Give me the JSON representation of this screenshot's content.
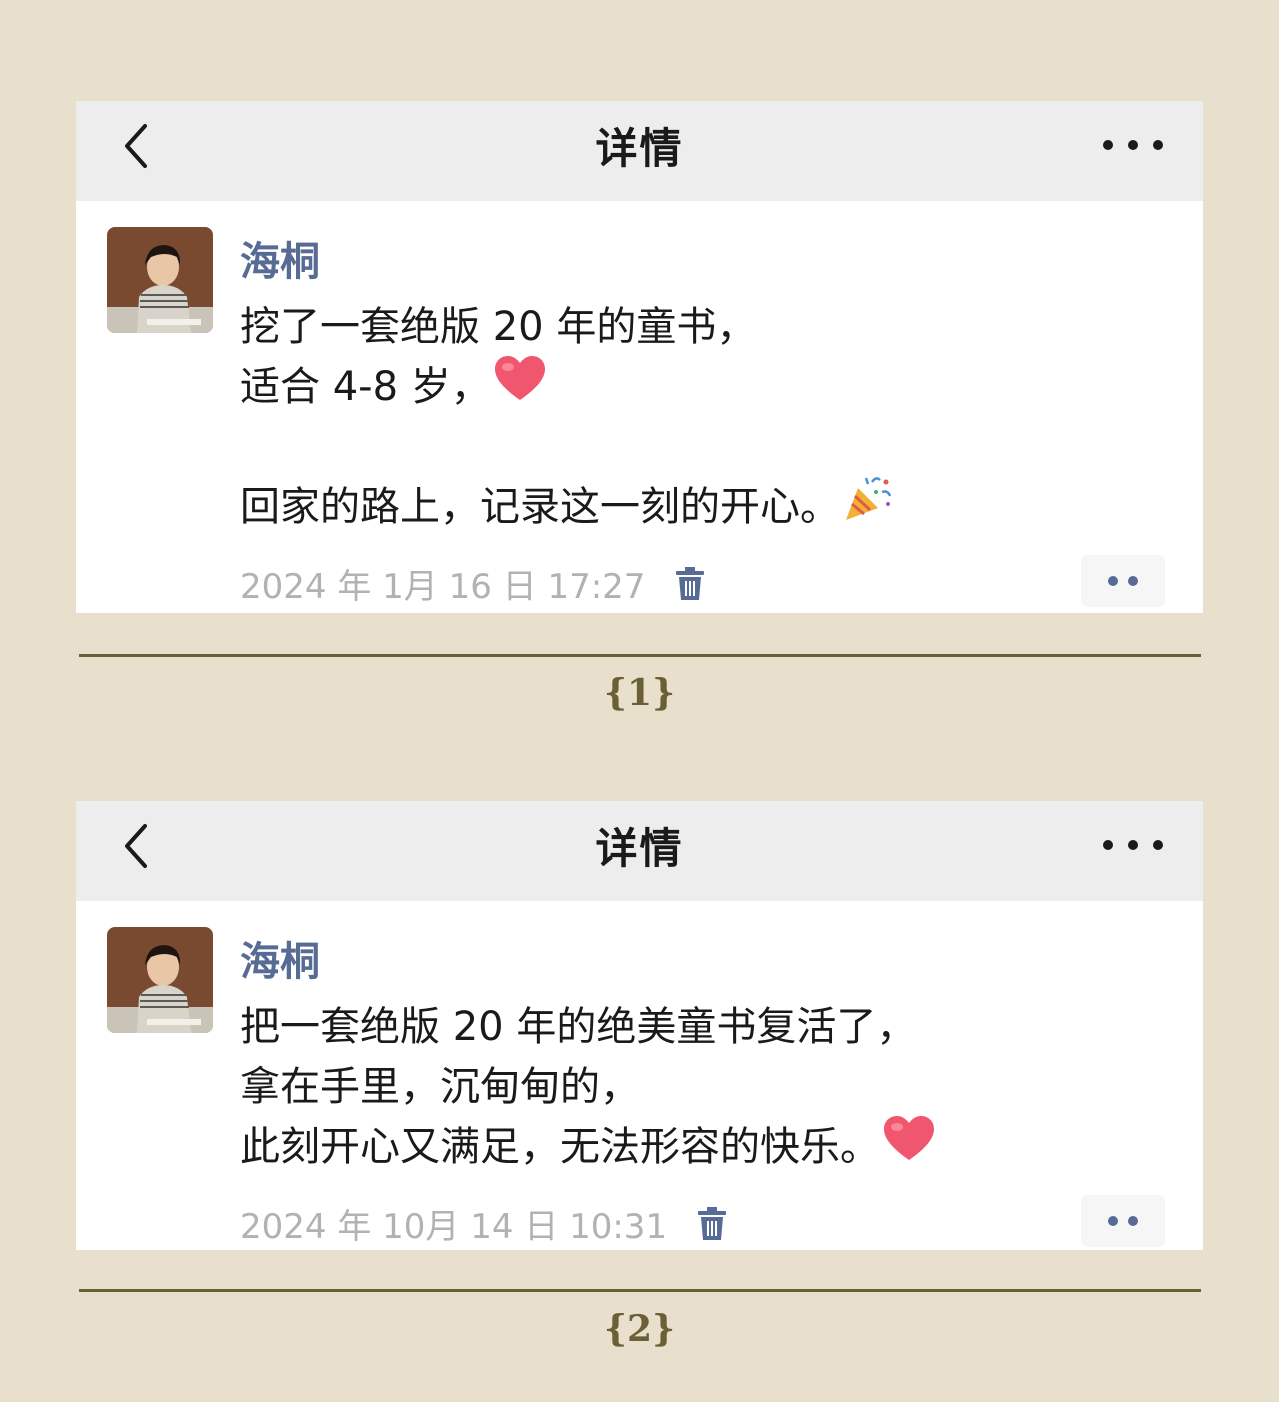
{
  "posts": [
    {
      "header": {
        "title": "详情"
      },
      "author": "海桐",
      "lines": [
        {
          "text": "挖了一套绝版 20 年的童书，",
          "emoji": ""
        },
        {
          "text": "适合 4-8 岁，",
          "emoji": "heart"
        },
        {
          "text": "",
          "emoji": ""
        },
        {
          "text": "回家的路上，记录这一刻的开心。",
          "emoji": "party-popper"
        }
      ],
      "timestamp": "2024 年 1月 16 日 17:27",
      "label": "{1}"
    },
    {
      "header": {
        "title": "详情"
      },
      "author": "海桐",
      "lines": [
        {
          "text": "把一套绝版 20 年的绝美童书复活了，",
          "emoji": ""
        },
        {
          "text": "拿在手里，沉甸甸的，",
          "emoji": ""
        },
        {
          "text": "此刻开心又满足，无法形容的快乐。",
          "emoji": "heart"
        }
      ],
      "timestamp": "2024 年 10月 14 日 10:31",
      "label": "{2}"
    }
  ],
  "icons": {
    "back": "chevron-left-icon",
    "more": "more-horizontal-icon",
    "trash": "trash-icon",
    "comment": "comment-dots-icon"
  },
  "colors": {
    "background": "#e8e0cd",
    "header_bg": "#ededed",
    "name_blue": "#576b95",
    "timestamp_gray": "#b2b2b2",
    "divider_olive": "#6b6035"
  }
}
